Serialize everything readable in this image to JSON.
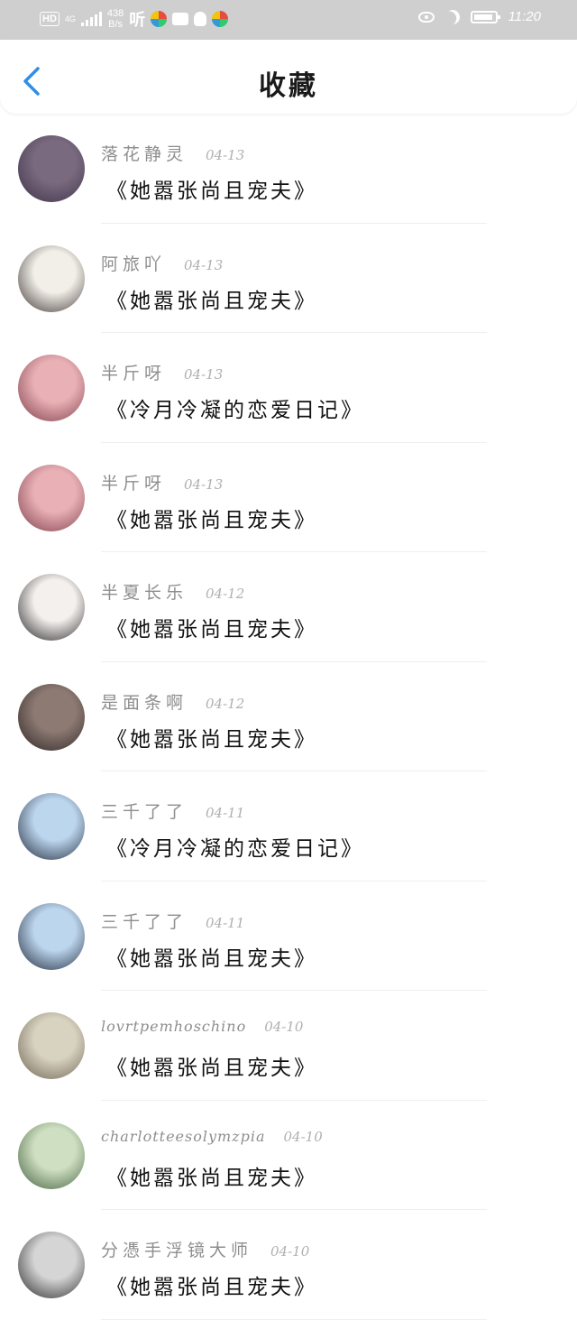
{
  "status_bar": {
    "hd": "HD",
    "net": "4G",
    "speed_value": "438",
    "speed_unit": "B/s",
    "app_text": "听",
    "time": "11:20"
  },
  "header": {
    "title": "收藏"
  },
  "colors": {
    "accent": "#2f8fe6",
    "status_bar_bg": "#cfcfcf"
  },
  "items": [
    {
      "user": "落花静灵",
      "date": "04-13",
      "title": "《她嚣张尚且宠夫》",
      "avatar": [
        "#7a6a7f",
        "#3b3245"
      ]
    },
    {
      "user": "阿旅吖",
      "date": "04-13",
      "title": "《她嚣张尚且宠夫》",
      "avatar": [
        "#f1efe8",
        "#3a3030"
      ]
    },
    {
      "user": "半斤呀",
      "date": "04-13",
      "title": "《冷月冷凝的恋爱日记》",
      "avatar": [
        "#e9b1b6",
        "#7b3a45"
      ]
    },
    {
      "user": "半斤呀",
      "date": "04-13",
      "title": "《她嚣张尚且宠夫》",
      "avatar": [
        "#e9b1b6",
        "#7b3a45"
      ]
    },
    {
      "user": "半夏长乐",
      "date": "04-12",
      "title": "《她嚣张尚且宠夫》",
      "avatar": [
        "#f4f0ee",
        "#1c1c1c"
      ]
    },
    {
      "user": "是面条啊",
      "date": "04-12",
      "title": "《她嚣张尚且宠夫》",
      "avatar": [
        "#8d7a73",
        "#2b2322"
      ]
    },
    {
      "user": "三千了了",
      "date": "04-11",
      "title": "《冷月冷凝的恋爱日记》",
      "avatar": [
        "#bcd6ee",
        "#1a2233"
      ]
    },
    {
      "user": "三千了了",
      "date": "04-11",
      "title": "《她嚣张尚且宠夫》",
      "avatar": [
        "#bcd6ee",
        "#1a2233"
      ]
    },
    {
      "user": "lovrtpemhoschino",
      "date": "04-10",
      "title": "《她嚣张尚且宠夫》",
      "latin": true,
      "avatar": [
        "#d8d2c0",
        "#6a6050"
      ]
    },
    {
      "user": "charlotteesolymzpia",
      "date": "04-10",
      "title": "《她嚣张尚且宠夫》",
      "latin": true,
      "avatar": [
        "#cfe0c2",
        "#3d5a3a"
      ]
    },
    {
      "user": "分憑手浮镜大师",
      "date": "04-10",
      "title": "《她嚣张尚且宠夫》",
      "avatar": [
        "#d5d5d5",
        "#222222"
      ]
    }
  ]
}
